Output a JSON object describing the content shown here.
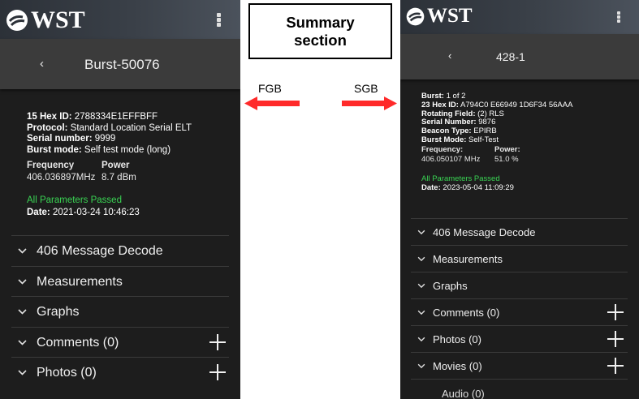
{
  "annotations": {
    "summary_box": [
      "Summary",
      "section"
    ],
    "fgb_label": "FGB",
    "sgb_label": "SGB",
    "arrow_color": "#ff2a2a"
  },
  "left_screen": {
    "brand": "WST",
    "title": "Burst-50076",
    "back": "‹",
    "summary": {
      "hex_id_label": "15 Hex ID:",
      "hex_id": " 2788334E1EFFBFF",
      "protocol_label": "Protocol:",
      "protocol": " Standard Location Serial ELT",
      "serial_label": "Serial number:",
      "serial": " 9999",
      "burst_mode_label": "Burst mode:",
      "burst_mode": " Self test mode (long)",
      "frequency_label": "Frequency",
      "power_label": "Power",
      "frequency": "406.036897MHz",
      "power": "8.7 dBm",
      "status": "All Parameters Passed",
      "date_label": "Date:",
      "date": " 2021-03-24 10:46:23"
    },
    "sections": [
      {
        "label": "406 Message Decode",
        "icon": "chevron-down-icon"
      },
      {
        "label": "Measurements",
        "icon": "chevron-down-icon"
      },
      {
        "label": "Graphs",
        "icon": "chevron-down-icon"
      },
      {
        "label": "Comments (0)",
        "icon": "chevron-down-icon",
        "action": "plus-icon"
      },
      {
        "label": "Photos (0)",
        "icon": "chevron-down-icon",
        "action": "plus-icon"
      }
    ]
  },
  "right_screen": {
    "brand": "WST",
    "title": "428-1",
    "back": "‹",
    "summary": {
      "burst_label": "Burst:",
      "burst": " 1 of 2",
      "hex_id_label": "23 Hex ID:",
      "hex_id": " A794C0 E66949 1D6F34 56AAA",
      "rotating_label": "Rotating Field:",
      "rotating": " (2) RLS",
      "serial_label": "Serial Number:",
      "serial": " 9876",
      "beacon_type_label": "Beacon Type:",
      "beacon_type": " EPIRB",
      "burst_mode_label": "Burst Mode:",
      "burst_mode": " Self-Test",
      "frequency_label": "Frequency:",
      "power_label": "Power:",
      "frequency": "406.050107 MHz",
      "power": "51.0 %",
      "status": "All Parameters Passed",
      "date_label": "Date:",
      "date": " 2023-05-04 11:09:29"
    },
    "sections": [
      {
        "label": "406 Message Decode",
        "icon": "chevron-down-icon"
      },
      {
        "label": "Measurements",
        "icon": "chevron-down-icon"
      },
      {
        "label": "Graphs",
        "icon": "chevron-down-icon"
      },
      {
        "label": "Comments (0)",
        "icon": "chevron-down-icon",
        "action": "plus-icon"
      },
      {
        "label": "Photos (0)",
        "icon": "chevron-down-icon",
        "action": "plus-icon"
      },
      {
        "label": "Movies (0)",
        "icon": "chevron-down-icon",
        "action": "plus-icon"
      }
    ],
    "cut_off_item": "Audio (0)"
  },
  "colors": {
    "screen_bg": "#1d1d1d",
    "titlebar_bg": "#3b3b3b",
    "passed_green": "#39d353"
  }
}
